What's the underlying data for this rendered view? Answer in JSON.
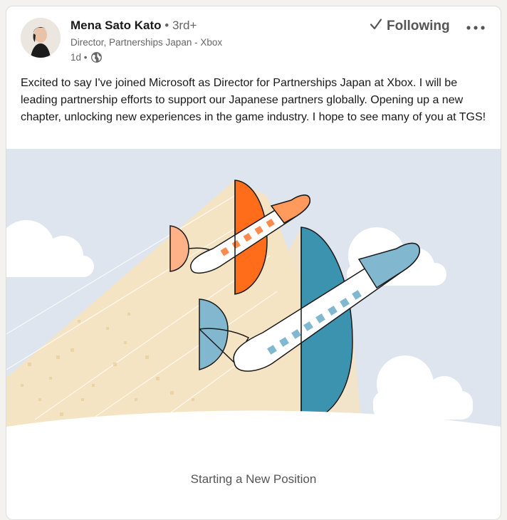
{
  "author": {
    "name": "Mena Sato Kato",
    "degree": "• 3rd+",
    "headline": "Director, Partnerships Japan - Xbox",
    "time": "1d •"
  },
  "follow": {
    "label": "Following",
    "icon": "check-icon"
  },
  "more": {
    "icon": "ellipsis-icon"
  },
  "post": {
    "text": "Excited to say I've joined Microsoft as Director for Partnerships Japan at Xbox. I will be leading partnership efforts to support our Japanese partners globally. Opening up a new chapter, unlocking new experiences in the game industry. I hope to see many of you at TGS!"
  },
  "media": {
    "caption": "Starting a New Position",
    "illustration": "two-airplanes-illustration",
    "colors": {
      "sky": "#dfe5ee",
      "trail": "#f5e4c3",
      "orange": "#ff6d1a",
      "orange_light": "#ff9a5c",
      "teal": "#3b93b0",
      "teal_light": "#82b8cf"
    }
  }
}
